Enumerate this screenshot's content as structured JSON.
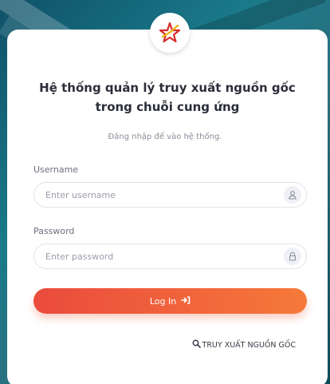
{
  "header": {
    "title_line1": "Hệ thống quản lý truy xuất nguồn gốc",
    "title_line2": "trong chuỗi cung ứng",
    "subtitle": "Đăng nhập để vào hệ thống."
  },
  "form": {
    "username": {
      "label": "Username",
      "placeholder": "Enter username",
      "value": "",
      "icon": "user-icon"
    },
    "password": {
      "label": "Password",
      "placeholder": "Enter password",
      "value": "",
      "icon": "lock-icon"
    },
    "login_label": "Log In",
    "login_icon": "sign-in-icon"
  },
  "trace_link": {
    "label": "TRUY XUẤT NGUỒN GỐC",
    "icon": "search-icon"
  },
  "colors": {
    "accent_start": "#ea4b3d",
    "accent_end": "#f6793a",
    "background": "#1a7a8a"
  }
}
